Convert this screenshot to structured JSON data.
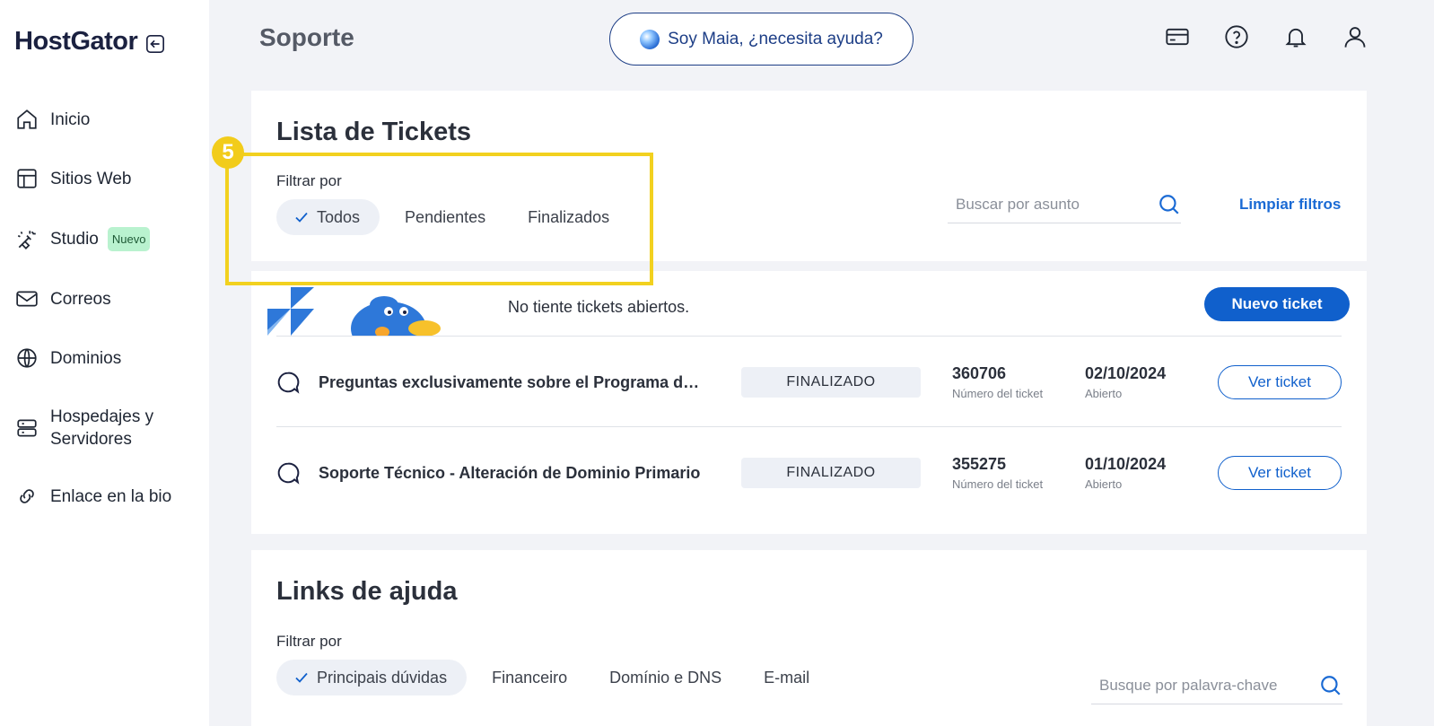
{
  "sidebar": {
    "logo": "HostGator",
    "items": [
      {
        "label": "Inicio",
        "icon": "home-icon"
      },
      {
        "label": "Sitios Web",
        "icon": "layout-icon"
      },
      {
        "label": "Studio",
        "icon": "wand-icon",
        "badge": "Nuevo"
      },
      {
        "label": "Correos",
        "icon": "mail-icon"
      },
      {
        "label": "Dominios",
        "icon": "globe-icon"
      },
      {
        "label": "Hospedajes y Servidores",
        "icon": "server-icon"
      },
      {
        "label": "Enlace en la bio",
        "icon": "link-icon"
      }
    ]
  },
  "header": {
    "title": "Soporte",
    "maia": "Soy Maia, ¿necesita ayuda?",
    "icons": [
      "card-icon",
      "help-icon",
      "bell-icon",
      "user-icon"
    ]
  },
  "tickets": {
    "title": "Lista de Tickets",
    "filter_label": "Filtrar por",
    "filters": [
      "Todos",
      "Pendientes",
      "Finalizados"
    ],
    "active_filter": "Todos",
    "search_placeholder": "Buscar por asunto",
    "clear_filters": "Limpiar filtros",
    "highlight_number": "5",
    "empty_message": "No tiente tickets abiertos.",
    "new_ticket": "Nuevo ticket",
    "rows": [
      {
        "subject": "Preguntas exclusivamente sobre el Programa de Afiliados",
        "status": "FINALIZADO",
        "number": "360706",
        "number_label": "Número del ticket",
        "date": "02/10/2024",
        "date_label": "Abierto",
        "action": "Ver ticket"
      },
      {
        "subject": "Soporte Técnico - Alteración de Dominio Primario",
        "status": "FINALIZADO",
        "number": "355275",
        "number_label": "Número del ticket",
        "date": "01/10/2024",
        "date_label": "Abierto",
        "action": "Ver ticket"
      }
    ]
  },
  "help_links": {
    "title": "Links de ajuda",
    "filter_label": "Filtrar por",
    "filters": [
      "Principais dúvidas",
      "Financeiro",
      "Domínio e DNS",
      "E-mail"
    ],
    "active_filter": "Principais dúvidas",
    "search_placeholder": "Busque por palavra-chave"
  },
  "colors": {
    "accent": "#1060cc",
    "brand_navy": "#1b2140",
    "highlight": "#f2d11f",
    "badge_green": "#b9f2cf"
  }
}
